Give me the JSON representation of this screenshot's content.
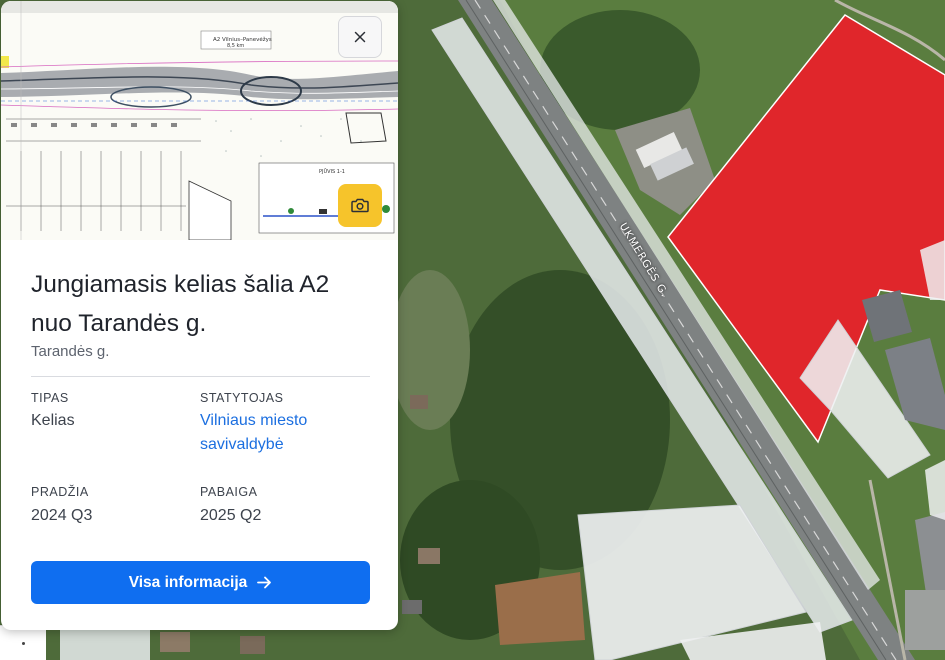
{
  "map": {
    "street_label": "UKMERGĖS G.",
    "colors": {
      "highlight_parcel": "#e0262b",
      "vegetation": "#4d6d3a",
      "road": "#7b7f7f"
    }
  },
  "card": {
    "image": {
      "plan_sign_line1": "A2 Vilnius–Panevėžys",
      "plan_sign_line2": "8,5 km",
      "plan_section_label": "PJŪVIS 1-1"
    },
    "close_icon": "close-icon",
    "camera_icon": "camera-icon",
    "title": "Jungiamasis kelias šalia A2 nuo Tarandės g.",
    "subtitle": "Tarandės g.",
    "fields": {
      "type_label": "TIPAS",
      "type_value": "Kelias",
      "builder_label": "STATYTOJAS",
      "builder_value": "Vilniaus miesto savivaldybė",
      "start_label": "PRADŽIA",
      "start_value": "2024 Q3",
      "end_label": "PABAIGA",
      "end_value": "2025 Q2"
    },
    "button_label": "Visa informacija",
    "button_icon": "arrow-right-icon",
    "accent_color": "#0f6ef0"
  }
}
